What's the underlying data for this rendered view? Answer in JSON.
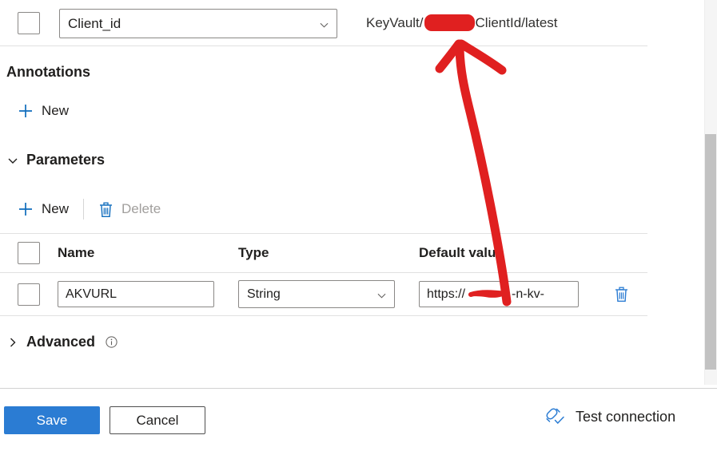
{
  "panel": {
    "credential_row": {
      "checkbox_checked": false,
      "dropdown_value": "Client_id",
      "keyvault_path_prefix": "KeyVault/",
      "keyvault_path_suffix": "ClientId/latest",
      "redacted": true
    },
    "annotations": {
      "heading": "Annotations",
      "new_label": "New"
    },
    "parameters": {
      "heading": "Parameters",
      "expanded": true,
      "toolbar": {
        "new_label": "New",
        "delete_label": "Delete",
        "delete_disabled": true
      },
      "columns": [
        "Name",
        "Type",
        "Default value"
      ],
      "rows": [
        {
          "checked": false,
          "name": "AKVURL",
          "type": "String",
          "default_value_prefix": "https://",
          "default_value_suffix": "-n-kv-",
          "default_value_redacted": true,
          "delete_icon": "trash-icon"
        }
      ]
    },
    "advanced": {
      "heading": "Advanced",
      "expanded": false,
      "info_icon": "info-icon"
    }
  },
  "footer": {
    "save_label": "Save",
    "cancel_label": "Cancel",
    "test_connection_label": "Test connection",
    "test_connection_icon": "plug-check-icon"
  },
  "colors": {
    "primary_button": "#2b7cd3",
    "accent_link": "#0f6cbd",
    "annotation_red": "#e02020",
    "text": "#201f1e",
    "disabled_text": "#a19f9d",
    "border": "#8a8886",
    "divider": "#e1e1e1"
  },
  "scrollbar": {
    "orientation": "vertical",
    "thumb_top_pct": 35,
    "thumb_height_pct": 61
  },
  "annotation": {
    "type": "hand-drawn-arrow",
    "color": "#e02020",
    "description": "red arrow pointing from Default value field up to KeyVault path",
    "redaction_blocks": 2
  }
}
